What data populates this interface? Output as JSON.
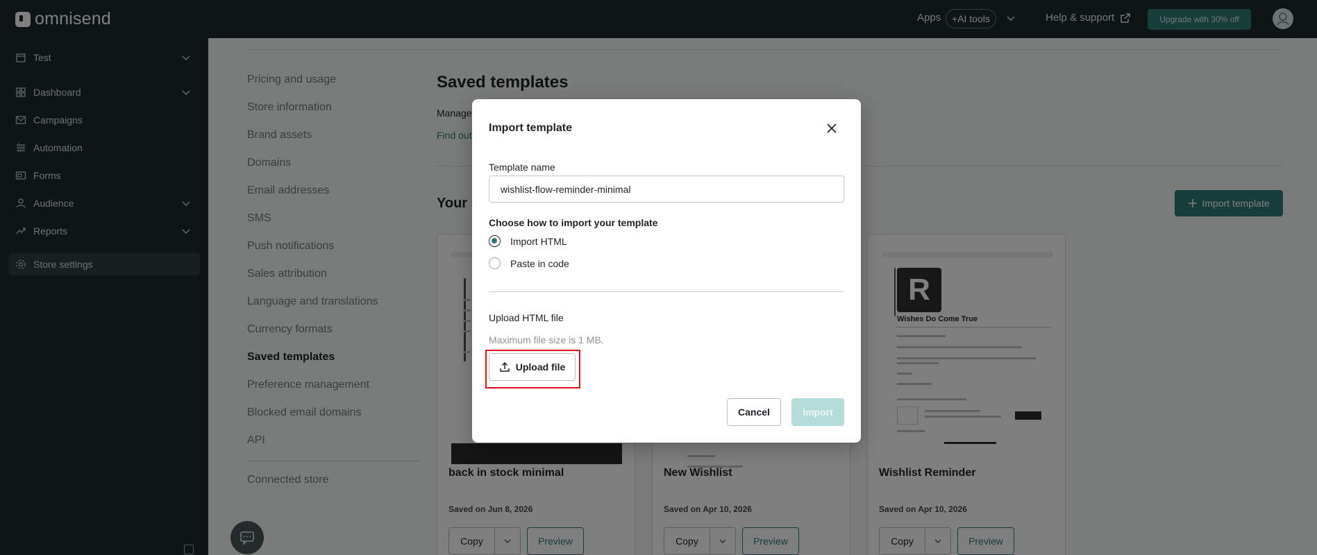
{
  "topbar": {
    "logo_text": "omnisend",
    "apps_label": "Apps",
    "ai_tools_label": "+AI tools",
    "help_label": "Help & support",
    "upgrade_label": "Upgrade with 30% off"
  },
  "sidebar": {
    "items": [
      {
        "label": "Test",
        "icon": "store-icon",
        "has_chevron": true
      },
      {
        "label": "Dashboard",
        "icon": "dashboard-icon",
        "has_chevron": true
      },
      {
        "label": "Campaigns",
        "icon": "mail-icon",
        "has_chevron": false
      },
      {
        "label": "Automation",
        "icon": "automation-icon",
        "has_chevron": false
      },
      {
        "label": "Forms",
        "icon": "forms-icon",
        "has_chevron": false
      },
      {
        "label": "Audience",
        "icon": "audience-icon",
        "has_chevron": true
      },
      {
        "label": "Reports",
        "icon": "reports-icon",
        "has_chevron": true
      },
      {
        "label": "Store settings",
        "icon": "gear-icon",
        "has_chevron": false,
        "active": true
      }
    ]
  },
  "settings_nav": {
    "items": [
      "Pricing and usage",
      "Store information",
      "Brand assets",
      "Domains",
      "Email addresses",
      "SMS",
      "Push notifications",
      "Sales attribution",
      "Language and translations",
      "Currency formats",
      "Saved templates",
      "Preference management",
      "Blocked email domains",
      "API"
    ],
    "current": "Saved templates",
    "connected_store": "Connected store"
  },
  "page": {
    "title": "Saved templates",
    "manage_text": "Manage",
    "findout_text": "Find out",
    "section_title": "Your s",
    "import_button": "Import template"
  },
  "cards": [
    {
      "name": "back in stock minimal",
      "date": "Saved on Jun 8, 2026",
      "copy_label": "Copy",
      "preview_label": "Preview"
    },
    {
      "name": "New Wishlist",
      "date": "Saved on Apr 10, 2026",
      "copy_label": "Copy",
      "preview_label": "Preview"
    },
    {
      "name": "Wishlist Reminder",
      "date": "Saved on Apr 10, 2026",
      "copy_label": "Copy",
      "preview_label": "Preview",
      "preview_logo": "R",
      "preview_title": "Wishes Do Come True"
    }
  ],
  "modal": {
    "title": "Import template",
    "name_label": "Template name",
    "name_value": "wishlist-flow-reminder-minimal",
    "choose_label": "Choose how to import your template",
    "options": [
      {
        "label": "Import HTML",
        "checked": true
      },
      {
        "label": "Paste in code",
        "checked": false
      }
    ],
    "upload_label": "Upload HTML file",
    "upload_hint": "Maximum file size is 1 MB.",
    "upload_button": "Upload file",
    "cancel_button": "Cancel",
    "import_button": "Import"
  },
  "colors": {
    "brand_dark": "#1b2b2c",
    "accent": "#2d7a74",
    "highlight": "#e0101a"
  }
}
